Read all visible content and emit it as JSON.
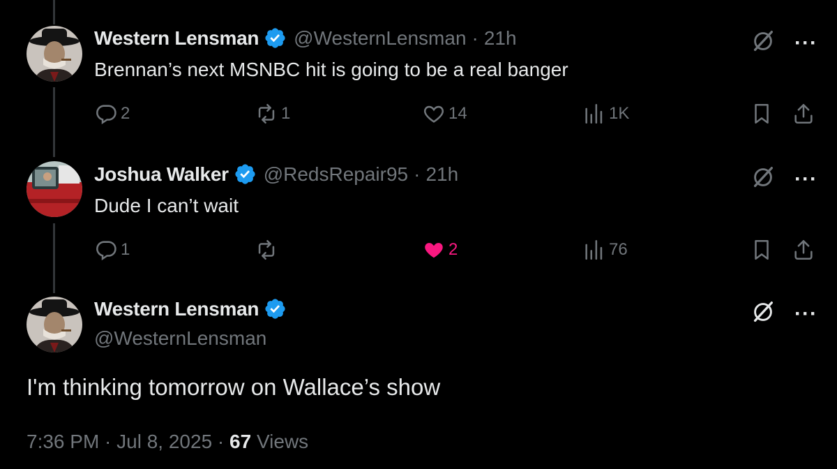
{
  "tweets": [
    {
      "name": "Western Lensman",
      "handle": "@WesternLensman",
      "sep": "·",
      "time": "21h",
      "text": "Brennan’s next MSNBC hit is going to be a real banger",
      "replies": "2",
      "retweets": "1",
      "likes": "14",
      "views": "1K",
      "liked": false
    },
    {
      "name": "Joshua Walker",
      "handle": "@RedsRepair95",
      "sep": "·",
      "time": "21h",
      "text": "Dude I can’t wait",
      "replies": "1",
      "retweets": "",
      "likes": "2",
      "views": "76",
      "liked": true
    }
  ],
  "main": {
    "name": "Western Lensman",
    "handle": "@WesternLensman",
    "text": "I'm thinking tomorrow on Wallace’s show",
    "timestamp": "7:36 PM · Jul 8, 2025 · ",
    "views_count": "67",
    "views_label": " Views"
  },
  "more_label": "···",
  "colors": {
    "verified": "#1d9bf0",
    "like": "#f91880",
    "muted": "#71767b",
    "text": "#e7e9ea"
  }
}
